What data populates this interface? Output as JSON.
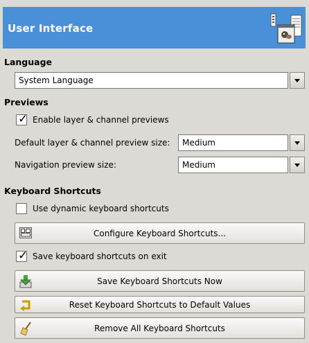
{
  "header": {
    "title": "User Interface",
    "icon": "user-interface-prefs-icon"
  },
  "language": {
    "section_title": "Language",
    "selected": "System Language"
  },
  "previews": {
    "section_title": "Previews",
    "enable_previews": {
      "label": "Enable layer & channel previews",
      "checked": true
    },
    "default_size": {
      "label": "Default layer & channel preview size:",
      "value": "Medium"
    },
    "nav_size": {
      "label": "Navigation preview size:",
      "value": "Medium"
    }
  },
  "keyboard": {
    "section_title": "Keyboard Shortcuts",
    "dynamic": {
      "label": "Use dynamic keyboard shortcuts",
      "checked": false
    },
    "configure_label": "Configure Keyboard Shortcuts...",
    "save_on_exit": {
      "label": "Save keyboard shortcuts on exit",
      "checked": true
    },
    "save_now_label": "Save Keyboard Shortcuts Now",
    "reset_label": "Reset Keyboard Shortcuts to Default Values",
    "remove_label": "Remove All Keyboard Shortcuts"
  }
}
